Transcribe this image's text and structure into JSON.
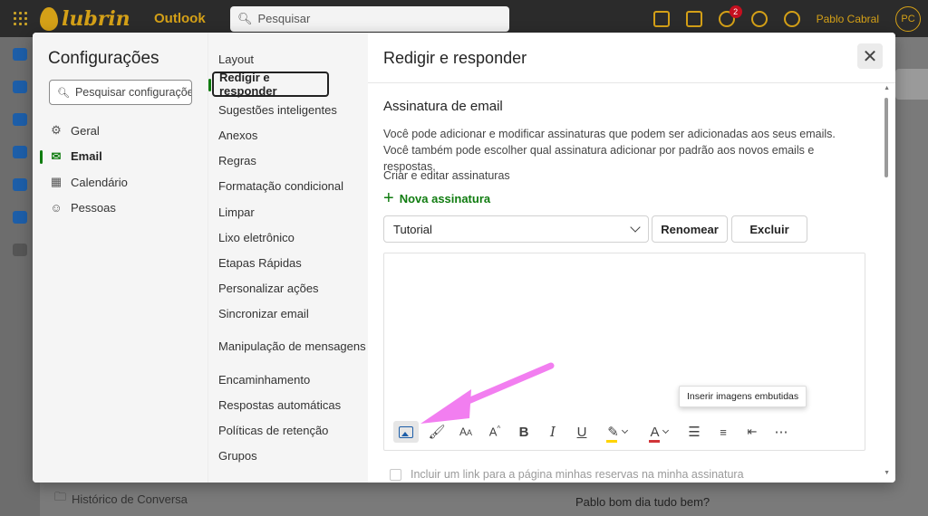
{
  "topbar": {
    "logo_text": "lubrin",
    "app_name": "Outlook",
    "search_placeholder": "Pesquisar",
    "notification_count": "2",
    "user_name": "Pablo Cabral",
    "user_initials": "PC"
  },
  "background": {
    "bottom_left_item": "Histórico de Conversa",
    "bottom_right_text": "Pablo bom dia tudo bem?"
  },
  "settings": {
    "title": "Configurações",
    "search_placeholder": "Pesquisar configurações",
    "categories": [
      {
        "label": "Geral",
        "icon": "gear-icon"
      },
      {
        "label": "Email",
        "icon": "mail-icon"
      },
      {
        "label": "Calendário",
        "icon": "calendar-icon"
      },
      {
        "label": "Pessoas",
        "icon": "people-icon"
      }
    ],
    "selected_category": "Email",
    "subcategories": [
      "Layout",
      "Redigir e responder",
      "Sugestões inteligentes",
      "Anexos",
      "Regras",
      "Formatação condicional",
      "Limpar",
      "Lixo eletrônico",
      "Etapas Rápidas",
      "Personalizar ações",
      "Sincronizar email",
      "Manipulação de mensagens",
      "Encaminhamento",
      "Respostas automáticas",
      "Políticas de retenção",
      "Grupos"
    ],
    "selected_subcategory": "Redigir e responder"
  },
  "pane": {
    "title": "Redigir e responder",
    "section_title": "Assinatura de email",
    "description": "Você pode adicionar e modificar assinaturas que podem ser adicionadas aos seus emails. Você também pode escolher qual assinatura adicionar por padrão aos novos emails e respostas.",
    "create_label": "Criar e editar assinaturas",
    "new_signature_label": "Nova assinatura",
    "signature_selected": "Tutorial",
    "rename_label": "Renomear",
    "delete_label": "Excluir",
    "tooltip": "Inserir imagens embutidas",
    "include_link_label": "Incluir um link para a página minhas reservas na minha assinatura",
    "toolbar": [
      "insert-image-icon",
      "format-painter-icon",
      "font-size-icon",
      "grow-font-icon",
      "bold-icon",
      "italic-icon",
      "underline-icon",
      "highlight-icon",
      "font-color-icon",
      "bullets-icon",
      "numbering-icon",
      "decrease-indent-icon",
      "more-icon"
    ]
  },
  "colors": {
    "accent": "#107c10",
    "brand": "#d4a017",
    "annotation_arrow": "#f27ef0"
  }
}
